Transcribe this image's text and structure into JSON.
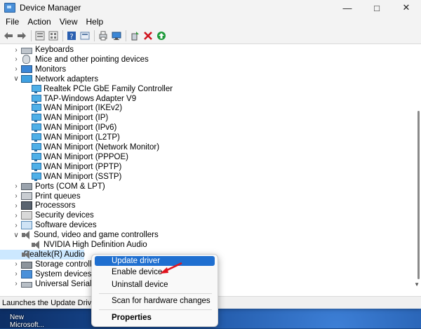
{
  "window": {
    "title": "Device Manager",
    "minimize_icon": "minimize-icon",
    "maximize_icon": "maximize-icon",
    "close_icon": "close-icon"
  },
  "menu": [
    "File",
    "Action",
    "View",
    "Help"
  ],
  "toolbar": [
    "back-arrow-icon",
    "forward-arrow-icon",
    "properties-pane-icon",
    "devices-grid-icon",
    "help-icon",
    "device-list-icon",
    "print-icon",
    "monitor-scan-icon",
    "add-driver-icon",
    "remove-x-icon",
    "update-arrow-icon"
  ],
  "tree": [
    {
      "label": "Keyboards",
      "level": 0,
      "expander": "collapsed",
      "icon": "keyboard"
    },
    {
      "label": "Mice and other pointing devices",
      "level": 0,
      "expander": "collapsed",
      "icon": "mouse"
    },
    {
      "label": "Monitors",
      "level": 0,
      "expander": "collapsed",
      "icon": "monitor"
    },
    {
      "label": "Network adapters",
      "level": 0,
      "expander": "expanded",
      "icon": "net"
    },
    {
      "label": "Realtek PCIe GbE Family Controller",
      "level": 1,
      "icon": "netadapter"
    },
    {
      "label": "TAP-Windows Adapter V9",
      "level": 1,
      "icon": "netadapter"
    },
    {
      "label": "WAN Miniport (IKEv2)",
      "level": 1,
      "icon": "netadapter"
    },
    {
      "label": "WAN Miniport (IP)",
      "level": 1,
      "icon": "netadapter"
    },
    {
      "label": "WAN Miniport (IPv6)",
      "level": 1,
      "icon": "netadapter"
    },
    {
      "label": "WAN Miniport (L2TP)",
      "level": 1,
      "icon": "netadapter"
    },
    {
      "label": "WAN Miniport (Network Monitor)",
      "level": 1,
      "icon": "netadapter"
    },
    {
      "label": "WAN Miniport (PPPOE)",
      "level": 1,
      "icon": "netadapter"
    },
    {
      "label": "WAN Miniport (PPTP)",
      "level": 1,
      "icon": "netadapter"
    },
    {
      "label": "WAN Miniport (SSTP)",
      "level": 1,
      "icon": "netadapter"
    },
    {
      "label": "Ports (COM & LPT)",
      "level": 0,
      "expander": "collapsed",
      "icon": "port"
    },
    {
      "label": "Print queues",
      "level": 0,
      "expander": "collapsed",
      "icon": "printer"
    },
    {
      "label": "Processors",
      "level": 0,
      "expander": "collapsed",
      "icon": "cpu"
    },
    {
      "label": "Security devices",
      "level": 0,
      "expander": "collapsed",
      "icon": "security"
    },
    {
      "label": "Software devices",
      "level": 0,
      "expander": "collapsed",
      "icon": "software"
    },
    {
      "label": "Sound, video and game controllers",
      "level": 0,
      "expander": "expanded",
      "icon": "sound"
    },
    {
      "label": "NVIDIA High Definition Audio",
      "level": 1,
      "icon": "sound"
    },
    {
      "label": "Realtek(R) Audio",
      "level": 1,
      "icon": "sound",
      "selected": true
    },
    {
      "label": "Storage controllers",
      "level": 0,
      "expander": "collapsed",
      "icon": "storage"
    },
    {
      "label": "System devices",
      "level": 0,
      "expander": "collapsed",
      "icon": "system"
    },
    {
      "label": "Universal Serial Bus",
      "level": 0,
      "expander": "collapsed",
      "icon": "usb"
    }
  ],
  "statusbar": {
    "text": "Launches the Update Driver Wiz"
  },
  "context_menu": {
    "items": [
      {
        "label": "Update driver",
        "highlighted": true
      },
      {
        "label": "Enable device"
      },
      {
        "label": "Uninstall device"
      },
      {
        "separator": true
      },
      {
        "label": "Scan for hardware changes"
      },
      {
        "separator": true
      },
      {
        "label": "Properties",
        "bold": true
      }
    ]
  },
  "annotation": {
    "arrow_color": "#e0141e"
  },
  "desktop": {
    "icon_label": "New Microsoft..."
  },
  "colors": {
    "selection": "#cce8ff",
    "menu_highlight": "#1f6fd0"
  }
}
